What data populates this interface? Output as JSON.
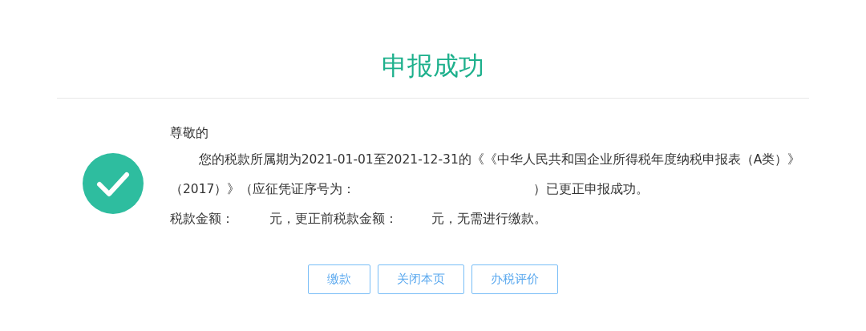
{
  "title": "申报成功",
  "message": {
    "greeting": "尊敬的",
    "body_before_blank": "您的税款所属期为2021-01-01至2021-12-31的《《中华人民共和国企业所得税年度纳税申报表（A类）》（2017）》（应征凭证序号为：",
    "body_after_blank": "）已更正申报成功。",
    "amount_label": "税款金额：",
    "amount_unit": "元，更正前税款金额：",
    "previous_unit": "元，无需进行缴款。"
  },
  "buttons": [
    "缴款",
    "关闭本页",
    "办税评价"
  ]
}
